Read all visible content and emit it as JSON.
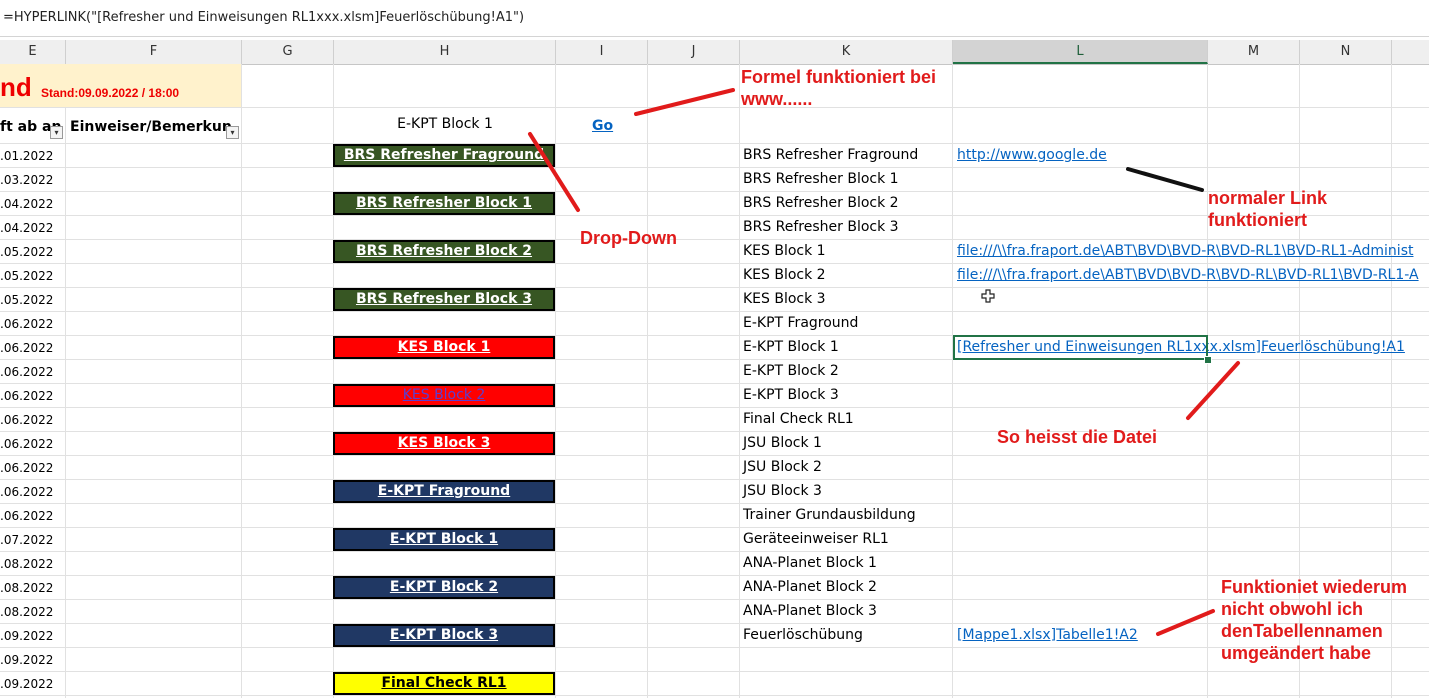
{
  "formula_bar": {
    "text": "=HYPERLINK(\"[Refresher und Einweisungen RL1xxx.xlsm]Feuerlöschübung!A1\")"
  },
  "columns": [
    "E",
    "F",
    "G",
    "H",
    "I",
    "J",
    "K",
    "L",
    "M",
    "N"
  ],
  "sheet": {
    "title_big": "nd",
    "title_stand": "Stand:09.09.2022 / 18:00",
    "header_e": "ft ab an",
    "header_f": "Einweiser/Bemerkun",
    "dropdown_value": "E-KPT Block 1",
    "go_link": "Go"
  },
  "dates": [
    ".01.2022",
    ".03.2022",
    ".04.2022",
    ".04.2022",
    ".05.2022",
    ".05.2022",
    ".05.2022",
    ".06.2022",
    ".06.2022",
    ".06.2022",
    ".06.2022",
    ".06.2022",
    ".06.2022",
    ".06.2022",
    ".06.2022",
    ".06.2022",
    ".07.2022",
    ".08.2022",
    ".08.2022",
    ".08.2022",
    ".09.2022",
    ".09.2022",
    ".09.2022"
  ],
  "buttons": [
    {
      "label": "BRS Refresher Fraground",
      "color": "green"
    },
    {
      "label": "BRS Refresher Block 1",
      "color": "green"
    },
    {
      "label": "BRS Refresher Block 2",
      "color": "green"
    },
    {
      "label": "BRS Refresher Block 3",
      "color": "green"
    },
    {
      "label": "KES Block 1",
      "color": "red"
    },
    {
      "label": "KES Block 2",
      "color": "red-visited"
    },
    {
      "label": "KES Block 3",
      "color": "red"
    },
    {
      "label": "E-KPT Fraground",
      "color": "navy"
    },
    {
      "label": "E-KPT Block 1",
      "color": "navy"
    },
    {
      "label": "E-KPT Block 2",
      "color": "navy"
    },
    {
      "label": "E-KPT Block 3",
      "color": "navy"
    },
    {
      "label": "Final Check RL1",
      "color": "yellow"
    }
  ],
  "k_list": [
    "BRS Refresher Fraground",
    "BRS Refresher Block 1",
    "BRS Refresher Block 2",
    "BRS Refresher Block 3",
    "KES Block 1",
    "KES Block 2",
    "KES Block 3",
    "E-KPT Fraground",
    "E-KPT Block 1",
    "E-KPT Block 2",
    "E-KPT Block 3",
    "Final Check RL1",
    "JSU Block 1",
    "JSU Block 2",
    "JSU Block 3",
    "Trainer Grundausbildung",
    "Geräteeinweiser RL1",
    "ANA-Planet Block 1",
    "ANA-Planet Block 2",
    "ANA-Planet Block 3",
    "Feuerlöschübung"
  ],
  "links": {
    "google": "http://www.google.de",
    "file1": "file:///\\\\fra.fraport.de\\ABT\\BVD\\BVD-R\\BVD-RL1\\BVD-RL1-Administ",
    "file2": "file:///\\\\fra.fraport.de\\ABT\\BVD\\BVD-R\\BVD-RL\\BVD-RL1\\BVD-RL1-A",
    "refresher": "[Refresher und Einweisungen RL1xxx.xlsm]Feuerlöschübung!A1",
    "mappe": "[Mappe1.xlsx]Tabelle1!A2"
  },
  "annotations": {
    "formel": "Formel funktioniert bei www......",
    "dropdown": "Drop-Down",
    "normaler": "normaler Link funktioniert",
    "datei": "So heisst die Datei",
    "funktioniet": "Funktioniet wiederum nicht obwohl ich denTabellennamen umgeändert habe"
  },
  "colors": {
    "accent": "#217346",
    "annotation": "#e11b1b",
    "link": "#0563c1",
    "green": "#375623",
    "navy": "#203864",
    "red": "#ff0000",
    "yellow": "#ffff00",
    "title_band": "#fff2cc"
  }
}
